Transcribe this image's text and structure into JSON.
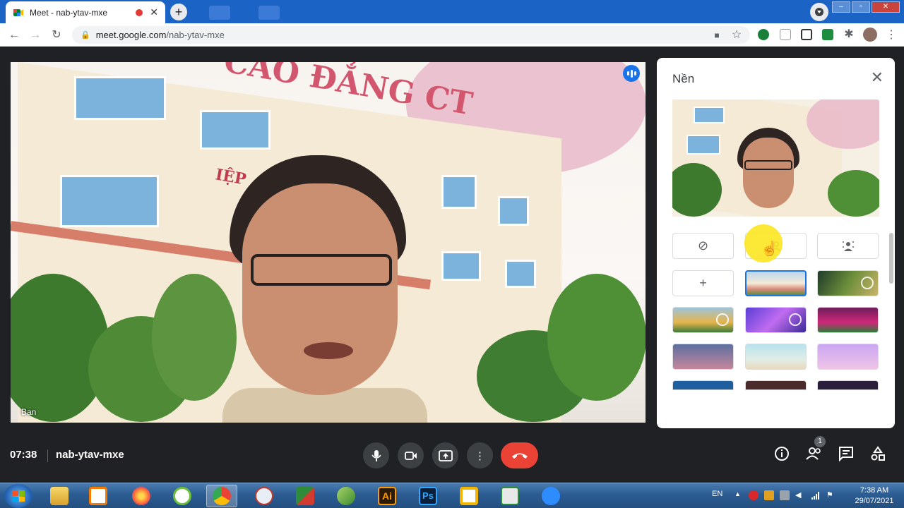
{
  "browser": {
    "tab_title": "Meet - nab-ytav-mxe",
    "tab_close": "✕",
    "new_tab": "+",
    "url_host": "meet.google.com",
    "url_path": "/nab-ytav-mxe"
  },
  "meet": {
    "participant_name": "Bạn",
    "panel_title": "Nền",
    "panel_close": "✕",
    "time": "07:38",
    "meeting_code": "nab-ytav-mxe",
    "participants_badge": "1",
    "add_background": "+",
    "no_effect": "⊘"
  },
  "video_sign": {
    "line1": "CAO ĐẲNG CT",
    "line2": "IỆP"
  },
  "taskbar": {
    "language": "EN",
    "clock_time": "7:38 AM",
    "clock_date": "29/07/2021",
    "ai_label": "Ai",
    "ps_label": "Ps"
  },
  "colors": {
    "chrome_tabstrip": "#1b63c4",
    "meet_background": "#202124",
    "end_call": "#ea4335",
    "selected_tile": "#1a73e8",
    "cursor_highlight": "#fbe521"
  }
}
